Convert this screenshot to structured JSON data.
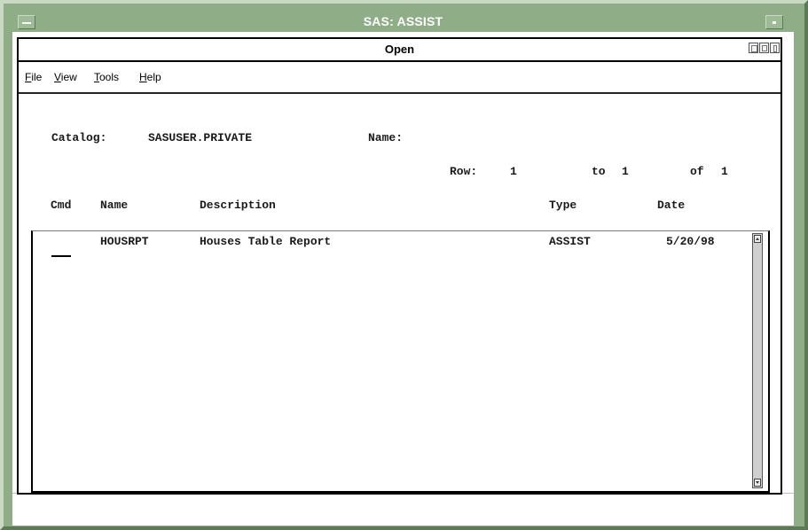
{
  "outer_window": {
    "title": "SAS: ASSIST"
  },
  "dialog": {
    "title": "Open"
  },
  "menu": {
    "items": [
      {
        "label_accel": "F",
        "label_rest": "ile"
      },
      {
        "label_accel": "V",
        "label_rest": "iew"
      },
      {
        "label_accel": "T",
        "label_rest": "ools"
      },
      {
        "label_accel": "H",
        "label_rest": "elp"
      }
    ]
  },
  "catalog": {
    "label": "Catalog:",
    "value": "SASUSER.PRIVATE",
    "name_label": "Name:"
  },
  "row_indicator": {
    "row_label": "Row:",
    "row_from": "1",
    "to_label": "to",
    "row_to": "1",
    "of_label": "of",
    "row_total": "1"
  },
  "table": {
    "headers": {
      "cmd": "Cmd",
      "name": "Name",
      "description": "Description",
      "type": "Type",
      "date": "Date"
    },
    "rows": [
      {
        "name": "HOUSRPT",
        "description": "Houses Table Report",
        "type": "ASSIST",
        "date": "5/20/98"
      }
    ]
  }
}
